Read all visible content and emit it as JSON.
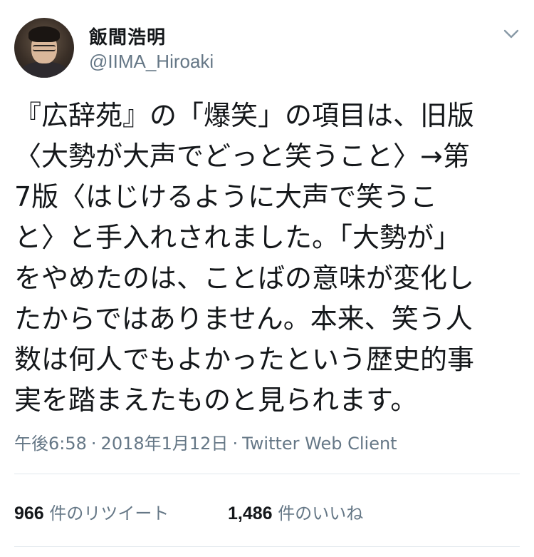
{
  "user": {
    "display_name": "飯間浩明",
    "handle": "@IIMA_Hiroaki",
    "avatar_icon": "avatar-photo"
  },
  "menu": {
    "icon": "chevron-down-icon"
  },
  "tweet": {
    "lines": [
      "『広辞苑』の「爆笑」の項目は、旧版",
      "〈大勢が大声でどっと笑うこと〉→第",
      "7版〈はじけるように大声で笑うこ",
      "と〉と手入れされました。「大勢が」",
      "をやめたのは、ことばの意味が変化し",
      "たからではありません。本来、笑う人",
      "数は何人でもよかったという歴史的事",
      "実を踏まえたものと見られます。"
    ]
  },
  "meta": {
    "time": "午後6:58",
    "separator": "·",
    "date": "2018年1月12日",
    "client": "Twitter Web Client"
  },
  "stats": {
    "retweets_count": "966",
    "retweets_label": "件のリツイート",
    "likes_count": "1,486",
    "likes_label": "件のいいね"
  },
  "colors": {
    "text": "#14171a",
    "secondary": "#657786",
    "divider": "#e1e8ed"
  }
}
